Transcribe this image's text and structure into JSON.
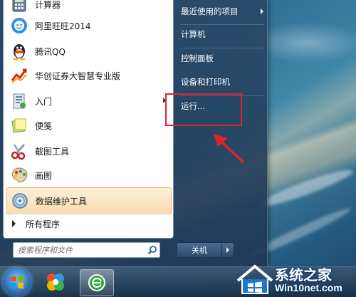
{
  "start_menu": {
    "programs": [
      {
        "label": "计算器",
        "icon": "calculator-icon"
      },
      {
        "label": "阿里旺旺2014",
        "icon": "aliwangwang-icon"
      },
      {
        "label": "腾讯QQ",
        "icon": "qq-penguin-icon"
      },
      {
        "label": "华创证券大智慧专业版",
        "icon": "stock-chart-icon"
      },
      {
        "label": "入门",
        "icon": "getting-started-icon"
      },
      {
        "label": "便笺",
        "icon": "sticky-notes-icon"
      },
      {
        "label": "截图工具",
        "icon": "scissors-icon"
      },
      {
        "label": "画图",
        "icon": "paint-palette-icon"
      },
      {
        "label": "数据维护工具",
        "icon": "disk-tool-icon"
      }
    ],
    "all_programs_label": "所有程序",
    "search_placeholder": "搜索程序和文件",
    "right_items": [
      {
        "label": "最近使用的项目"
      },
      {
        "label": "计算机"
      },
      {
        "label": "控制面板"
      },
      {
        "label": "设备和打印机"
      },
      {
        "label": "运行..."
      }
    ],
    "shutdown_label": "关机"
  },
  "watermark": {
    "title": "系统之家",
    "url": "Win10net.com"
  },
  "colors": {
    "highlight_border": "#e8b86a",
    "annotation_red": "#e1242a"
  }
}
